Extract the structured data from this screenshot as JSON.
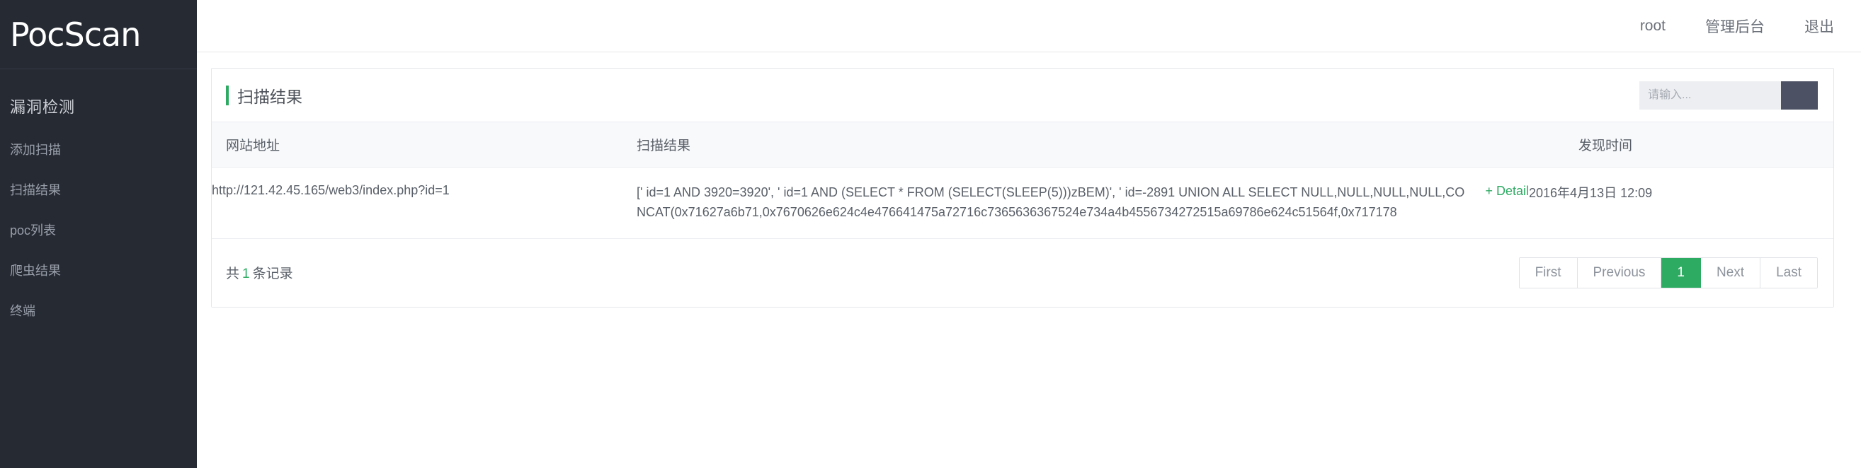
{
  "sidebar": {
    "brand": "PocScan",
    "nav_title": "漏洞检测",
    "items": [
      {
        "label": "添加扫描"
      },
      {
        "label": "扫描结果"
      },
      {
        "label": "poc列表"
      },
      {
        "label": "爬虫结果"
      },
      {
        "label": "终端"
      }
    ]
  },
  "topbar": {
    "user": "root",
    "admin": "管理后台",
    "logout": "退出"
  },
  "panel": {
    "title": "扫描结果",
    "accent_color": "#2eab63",
    "search": {
      "placeholder": "请输入...",
      "value": "",
      "button_icon": "search-icon"
    },
    "table": {
      "headers": {
        "url": "网站地址",
        "result": "扫描结果",
        "time": "发现时间"
      },
      "rows": [
        {
          "url": "http://121.42.45.165/web3/index.php?id=1",
          "result": "[' id=1 AND 3920=3920', ' id=1 AND (SELECT * FROM (SELECT(SLEEP(5)))zBEM)', ' id=-2891 UNION ALL SELECT NULL,NULL,NULL,NULL,CONCAT(0x71627a6b71,0x7670626e624c4e476641475a72716c7365636367524e734a4b4556734272515a69786e624c51564f,0x717178",
          "detail": "+ Detail",
          "time": "2016年4月13日 12:09"
        }
      ]
    },
    "footer": {
      "count_prefix": "共",
      "count": "1",
      "count_suffix": "条记录",
      "pager": [
        {
          "label": "First",
          "active": false
        },
        {
          "label": "Previous",
          "active": false
        },
        {
          "label": "1",
          "active": true
        },
        {
          "label": "Next",
          "active": false
        },
        {
          "label": "Last",
          "active": false
        }
      ]
    }
  }
}
